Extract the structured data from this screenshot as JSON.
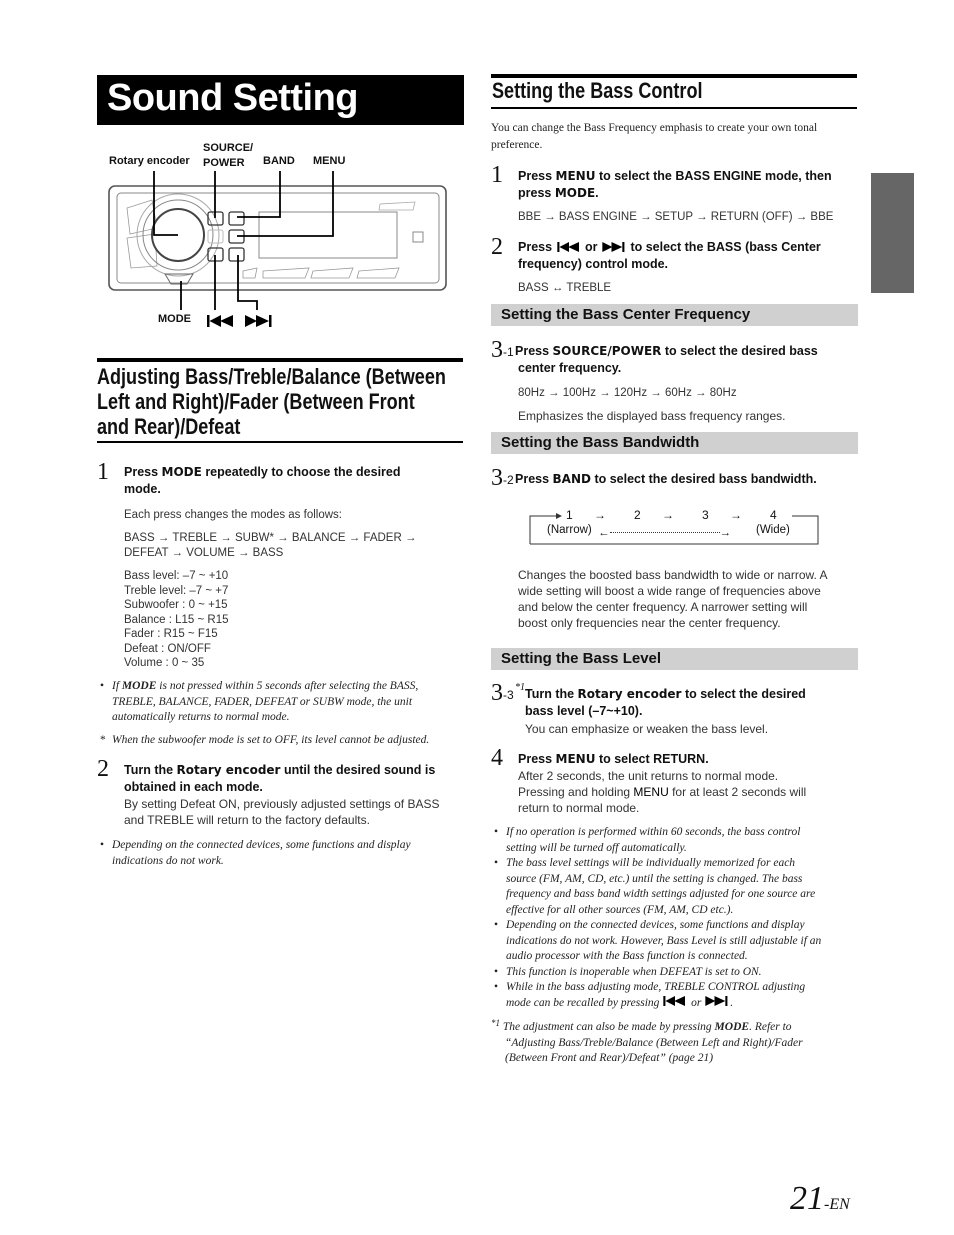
{
  "page": {
    "title": "Sound Setting",
    "page_number": "21",
    "page_suffix": "-EN",
    "side_tab_color": "#666666"
  },
  "diagram": {
    "labels": {
      "rotary_encoder": "Rotary encoder",
      "source_power_line1": "SOURCE/",
      "source_power_line2": "POWER",
      "band": "BAND",
      "menu": "MENU",
      "mode": "MODE",
      "prev_icon": "previous-track-icon",
      "next_icon": "next-track-icon"
    }
  },
  "left": {
    "heading_lines": [
      "Adjusting Bass/Treble/Balance (Between",
      "Left and Right)/Fader (Between Front",
      "and Rear)/Defeat"
    ],
    "step1": {
      "number": "1",
      "title_pre": "Press ",
      "title_key": "MODE",
      "title_post": " repeatedly to choose the desired",
      "title_line2": "mode.",
      "intro": "Each press changes the modes as follows:",
      "sequence_line1": "BASS → TREBLE → SUBW* → BALANCE → FADER →",
      "sequence_line2": "DEFEAT → VOLUME → BASS",
      "ranges": [
        "Bass level: –7 ~ +10",
        "Treble level: –7 ~ +7",
        "Subwoofer : 0 ~ +15",
        "Balance : L15 ~ R15",
        "Fader : R15 ~ F15",
        "Defeat : ON/OFF",
        "Volume : 0 ~ 35"
      ]
    },
    "note1": {
      "key": "MODE",
      "pre": "If ",
      "line1": " is not pressed within 5 seconds after selecting the BASS,",
      "line2": "TREBLE, BALANCE, FADER, DEFEAT or SUBW mode, the unit",
      "line3": "automatically returns to normal mode."
    },
    "asterisk_note": "When the subwoofer mode is set to OFF, its level cannot be adjusted.",
    "step2": {
      "number": "2",
      "title_pre": "Turn the ",
      "title_key": "Rotary encoder",
      "title_post": " until the desired sound is",
      "title_line2": "obtained in each mode.",
      "body_line1": "By setting Defeat ON, previously adjusted settings of BASS",
      "body_line2": "and TREBLE will return to the factory defaults."
    },
    "note2": {
      "line1": "Depending on the connected devices, some functions and display",
      "line2": "indications do not work."
    }
  },
  "right": {
    "heading": "Setting the Bass Control",
    "intro_line1": "You can change the Bass Frequency emphasis to create your own tonal",
    "intro_line2": "preference.",
    "step1": {
      "number": "1",
      "pre": "Press ",
      "key1": "MENU",
      "mid": " to select the BASS ENGINE mode, then",
      "line2_pre": "press ",
      "key2": "MODE",
      "line2_post": ".",
      "sequence": "BBE → BASS ENGINE → SETUP → RETURN (OFF) → BBE"
    },
    "step2": {
      "number": "2",
      "pre": "Press ",
      "or": " or ",
      "post": " to select the BASS (bass Center",
      "line2": "frequency) control mode.",
      "sequence": "BASS ↔ TREBLE"
    },
    "sub1": {
      "heading": "Setting the Bass Center Frequency",
      "step_number": "3",
      "step_suffix": "-1",
      "pre": " Press ",
      "key": "SOURCE/POWER",
      "post": " to select the desired bass",
      "line2": "center frequency.",
      "sequence": "80Hz → 100Hz → 120Hz → 60Hz → 80Hz",
      "description": "Emphasizes the displayed bass frequency ranges."
    },
    "sub2": {
      "heading": "Setting the Bass Bandwidth",
      "step_number": "3",
      "step_suffix": "-2",
      "pre": " Press ",
      "key": "BAND",
      "post": " to select the desired bass bandwidth.",
      "bandwidth_values": [
        "1",
        "2",
        "3",
        "4"
      ],
      "narrow_label": "(Narrow)",
      "wide_label": "(Wide)",
      "desc_lines": [
        "Changes the boosted bass bandwidth to wide or narrow. A",
        "wide setting will boost a wide range of frequencies above",
        "and below the center frequency. A narrower setting will",
        "boost only frequencies near the center frequency."
      ]
    },
    "sub3": {
      "heading": "Setting the Bass Level",
      "step_number": "3",
      "step_suffix": "-3",
      "footnote_mark": "*1",
      "pre": "Turn the ",
      "key": "Rotary encoder",
      "post": " to select the desired",
      "line2": "bass level (–7~+10).",
      "body": "You can emphasize or weaken the bass level."
    },
    "step4": {
      "number": "4",
      "pre": "Press ",
      "key": "MENU",
      "post": " to select RETURN.",
      "body_line1": "After 2 seconds, the unit returns to normal mode.",
      "body_line2_pre": "Pressing and holding ",
      "body_line2_key": "MENU",
      "body_line2_post": " for at least 2 seconds will",
      "body_line3": "return to normal mode."
    },
    "notes": [
      [
        "If no operation is performed within 60 seconds, the bass control",
        "setting will be turned off automatically."
      ],
      [
        "The bass level settings will be individually memorized for each",
        "source (FM, AM, CD, etc.) until the setting is changed. The bass",
        "frequency and bass band width settings adjusted for one source are",
        "effective for all other sources (FM, AM, CD etc.)."
      ],
      [
        "Depending on the connected devices, some functions and display",
        "indications do not work. However, Bass Level is still adjustable if an",
        "audio processor with the Bass function is connected."
      ],
      [
        "This function is inoperable when DEFEAT is set to ON."
      ]
    ],
    "last_note": {
      "line1": "While in the bass adjusting mode, TREBLE CONTROL adjusting",
      "line2_pre": "mode can be recalled by pressing ",
      "or": " or ",
      "end": "."
    },
    "footnote": {
      "mark": "*1",
      "pre": " The adjustment can also be made by pressing ",
      "key": "MODE",
      "post": ". Refer to",
      "line2": "“Adjusting Bass/Treble/Balance (Between Left and Right)/Fader",
      "line3": "(Between Front and Rear)/Defeat” (page 21)"
    }
  }
}
